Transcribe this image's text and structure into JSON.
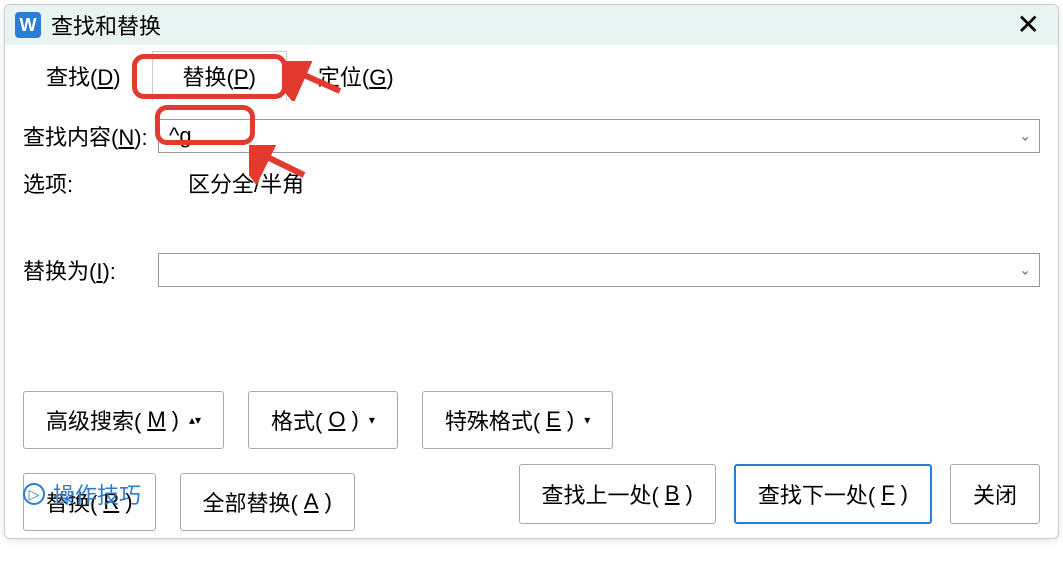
{
  "title": "查找和替换",
  "tabs": {
    "find": "查找(",
    "find_key": "D",
    "find_end": ")",
    "replace": "替换(",
    "replace_key": "P",
    "replace_end": ")",
    "goto": "定位(",
    "goto_key": "G",
    "goto_end": ")"
  },
  "form": {
    "find_label": "查找内容(",
    "find_key": "N",
    "find_end": "):",
    "find_value": "^g",
    "options_label": "选项:",
    "options_value": "区分全/半角",
    "replace_label": "替换为(",
    "replace_key": "I",
    "replace_end": "):",
    "replace_value": ""
  },
  "buttons": {
    "advanced": "高级搜索(",
    "advanced_key": "M",
    "advanced_end": ")",
    "format": "格式(",
    "format_key": "O",
    "format_end": ")",
    "special": "特殊格式(",
    "special_key": "E",
    "special_end": ")",
    "replace": "替换(",
    "replace_key": "R",
    "replace_end": ")",
    "replace_all": "全部替换(",
    "replace_all_key": "A",
    "replace_all_end": ")",
    "find_prev": "查找上一处(",
    "find_prev_key": "B",
    "find_prev_end": ")",
    "find_next": "查找下一处(",
    "find_next_key": "F",
    "find_next_end": ")",
    "close": "关闭"
  },
  "footer": {
    "tips": "操作技巧"
  }
}
